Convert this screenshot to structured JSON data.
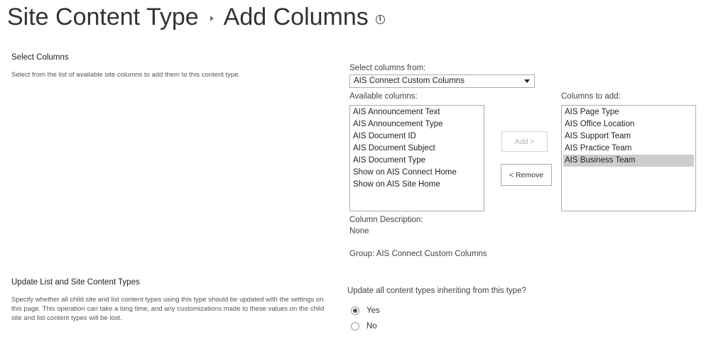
{
  "page": {
    "title_parent": "Site Content Type",
    "title_current": "Add Columns",
    "info_icon": "info-icon"
  },
  "select_columns": {
    "heading": "Select Columns",
    "description": "Select from the list of available site columns to add them to this content type.",
    "from_label": "Select columns from:",
    "from_value": "AIS Connect Custom Columns",
    "available_label": "Available columns:",
    "available": [
      "AIS Announcement Text",
      "AIS Announcement Type",
      "AIS Document ID",
      "AIS Document Subject",
      "AIS Document Type",
      "Show on AIS Connect Home",
      "Show on AIS Site Home"
    ],
    "add_button": "Add >",
    "remove_button": "< Remove",
    "to_add_label": "Columns to add:",
    "to_add": [
      "AIS Page Type",
      "AIS Office Location",
      "AIS Support Team",
      "AIS Practice Team",
      "AIS Business Team"
    ],
    "selected_to_add_index": 4,
    "column_description_label": "Column Description:",
    "column_description_value": "None",
    "group_text": "Group: AIS Connect Custom Columns"
  },
  "update_types": {
    "heading": "Update List and Site Content Types",
    "description": "Specify whether all child site and list content types using this type should be updated with the settings on this page. This operation can take a long time, and any customizations made to these values on the child site and list content types will be lost.",
    "question": "Update all content types inheriting from this type?",
    "yes_label": "Yes",
    "no_label": "No",
    "selected": "Yes"
  }
}
